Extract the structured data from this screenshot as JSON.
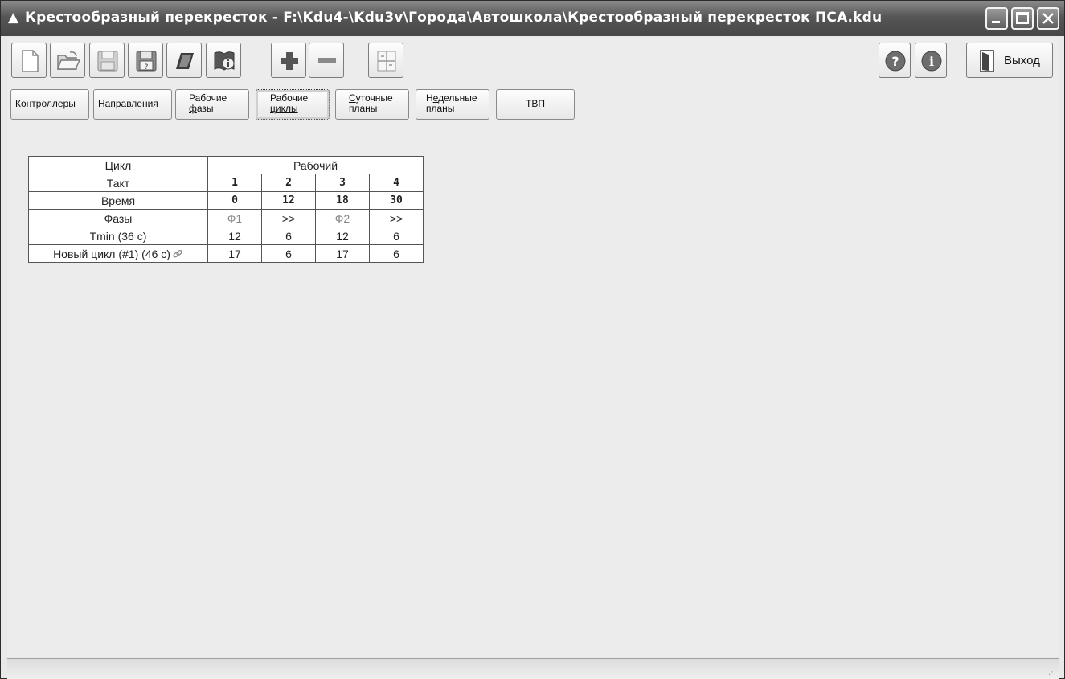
{
  "window": {
    "title": "Крестообразный перекресток - F:\\Kdu4-\\Kdu3v\\Города\\Автошкола\\Крестообразный перекресток ПСА.kdu",
    "title_icon": "warning-triangle-icon"
  },
  "toolbar": {
    "buttons": [
      {
        "name": "new-document",
        "icon": "new-document-icon"
      },
      {
        "name": "open-folder",
        "icon": "open-folder-icon"
      },
      {
        "name": "save",
        "icon": "floppy-disk-icon"
      },
      {
        "name": "save-as",
        "icon": "floppy-save-as-icon"
      },
      {
        "name": "erase",
        "icon": "eraser-icon"
      },
      {
        "name": "info-book",
        "icon": "book-info-icon"
      },
      {
        "name": "add",
        "icon": "plus-icon"
      },
      {
        "name": "remove",
        "icon": "minus-icon"
      },
      {
        "name": "layout",
        "icon": "layout-grid-icon"
      }
    ],
    "help_icon": "question-circle-icon",
    "info_icon": "info-circle-icon",
    "exit_label": "Выход"
  },
  "tabs": [
    {
      "label": "Контроллеры",
      "underline": "К",
      "rest": "онтроллеры"
    },
    {
      "label": "Направления",
      "underline": "Н",
      "rest": "аправления"
    },
    {
      "line1": "Рабочие",
      "line2_u": "ф",
      "line2_rest": "азы"
    },
    {
      "line1": "Рабочие",
      "line2": "циклы",
      "active": true
    },
    {
      "line1_u": "С",
      "line1_rest": "уточные",
      "line2": "планы"
    },
    {
      "line1_pre": "Н",
      "line1_u": "е",
      "line1_rest": "дельные",
      "line2": "планы"
    },
    {
      "label": "ТВП"
    }
  ],
  "cycle_table": {
    "header_label": "Цикл",
    "header_value": "Рабочий",
    "rows": [
      {
        "label": "Такт",
        "values": [
          "1",
          "2",
          "3",
          "4"
        ]
      },
      {
        "label": "Время",
        "values": [
          "0",
          "12",
          "18",
          "30"
        ]
      },
      {
        "label": "Фазы",
        "values": [
          "Ф1",
          ">>",
          "Ф2",
          ">>"
        ]
      },
      {
        "label": "Tmin (36 c)",
        "values": [
          "12",
          "6",
          "12",
          "6"
        ]
      },
      {
        "label": "Новый цикл (#1) (46 с)",
        "values": [
          "17",
          "6",
          "17",
          "6"
        ],
        "icon": "chain-link-icon"
      }
    ]
  }
}
